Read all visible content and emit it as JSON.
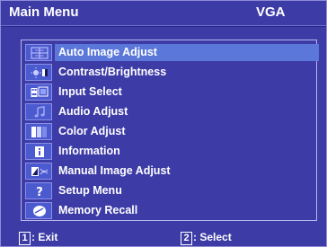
{
  "header": {
    "title": "Main Menu",
    "signal": "VGA"
  },
  "menu": {
    "items": [
      {
        "label": "Auto Image Adjust",
        "icon": "auto-adjust-icon"
      },
      {
        "label": "Contrast/Brightness",
        "icon": "contrast-brightness-icon"
      },
      {
        "label": "Input Select",
        "icon": "input-select-icon"
      },
      {
        "label": "Audio Adjust",
        "icon": "audio-icon"
      },
      {
        "label": "Color Adjust",
        "icon": "color-icon"
      },
      {
        "label": "Information",
        "icon": "information-icon"
      },
      {
        "label": "Manual Image Adjust",
        "icon": "manual-adjust-icon"
      },
      {
        "label": "Setup Menu",
        "icon": "setup-icon"
      },
      {
        "label": "Memory Recall",
        "icon": "memory-recall-icon"
      }
    ],
    "selected_index": 0
  },
  "footer": {
    "exit_key": "1",
    "exit_label": ": Exit",
    "select_key": "2",
    "select_label": ": Select"
  },
  "colors": {
    "background": "#3d3ba6",
    "highlight": "#5a77d9",
    "text": "#ffffff"
  }
}
